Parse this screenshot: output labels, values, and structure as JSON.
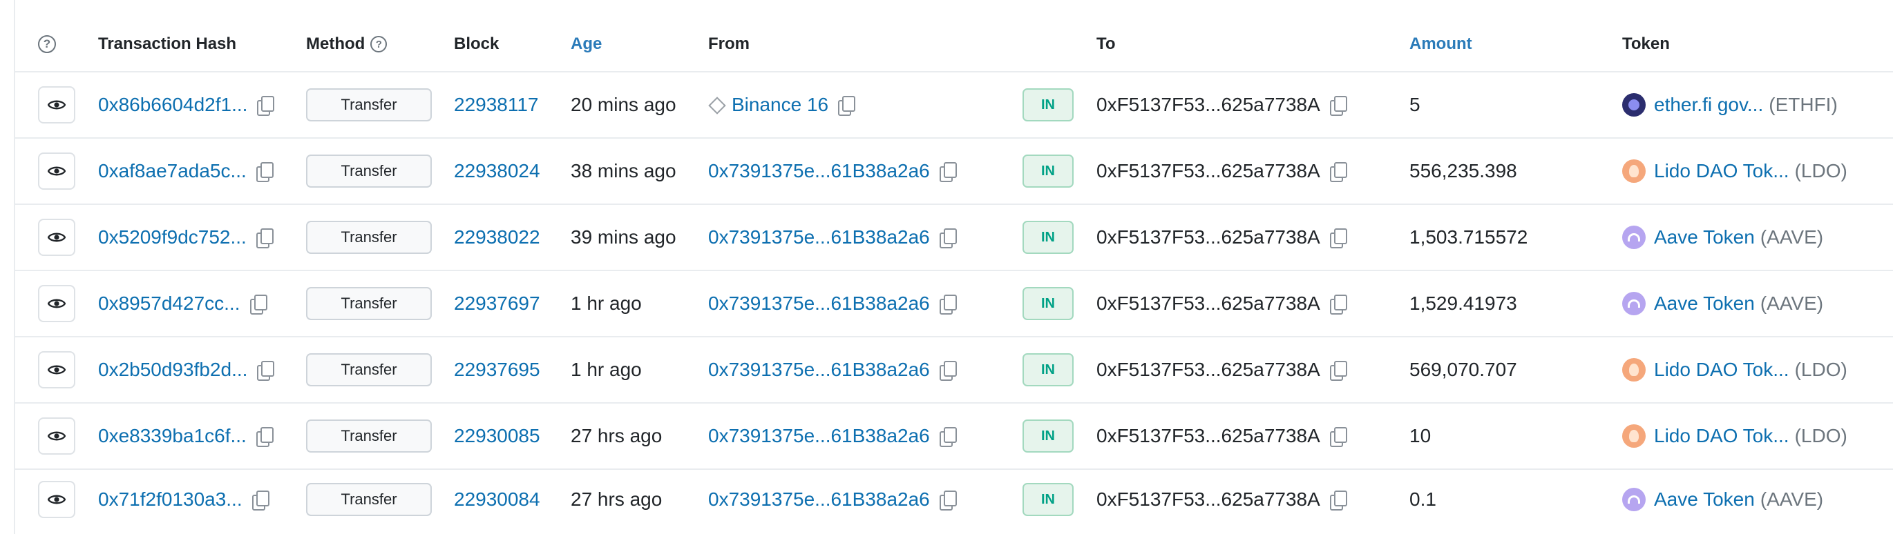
{
  "header": {
    "info_icon": "question-circle-icon",
    "transaction_hash": "Transaction Hash",
    "method": "Method",
    "block": "Block",
    "age": "Age",
    "from": "From",
    "to": "To",
    "amount": "Amount",
    "token": "Token"
  },
  "colors": {
    "link": "#0d6fb0",
    "in_badge_text": "#00a186",
    "in_badge_bg": "#e6f4ec"
  },
  "rows": [
    {
      "hash": "0x86b6604d2f1...",
      "method": "Transfer",
      "block": "22938117",
      "age": "20 mins ago",
      "from": "Binance 16",
      "from_is_contract": true,
      "direction": "IN",
      "to": "0xF5137F53...625a7738A",
      "amount": "5",
      "token_name": "ether.fi gov...",
      "token_symbol": "(ETHFI)",
      "token_logo": "ethfi"
    },
    {
      "hash": "0xaf8ae7ada5c...",
      "method": "Transfer",
      "block": "22938024",
      "age": "38 mins ago",
      "from": "0x7391375e...61B38a2a6",
      "from_is_contract": false,
      "direction": "IN",
      "to": "0xF5137F53...625a7738A",
      "amount": "556,235.398",
      "token_name": "Lido DAO Tok...",
      "token_symbol": "(LDO)",
      "token_logo": "ldo"
    },
    {
      "hash": "0x5209f9dc752...",
      "method": "Transfer",
      "block": "22938022",
      "age": "39 mins ago",
      "from": "0x7391375e...61B38a2a6",
      "from_is_contract": false,
      "direction": "IN",
      "to": "0xF5137F53...625a7738A",
      "amount": "1,503.715572",
      "token_name": "Aave Token",
      "token_symbol": "(AAVE)",
      "token_logo": "aave"
    },
    {
      "hash": "0x8957d427cc...",
      "method": "Transfer",
      "block": "22937697",
      "age": "1 hr ago",
      "from": "0x7391375e...61B38a2a6",
      "from_is_contract": false,
      "direction": "IN",
      "to": "0xF5137F53...625a7738A",
      "amount": "1,529.41973",
      "token_name": "Aave Token",
      "token_symbol": "(AAVE)",
      "token_logo": "aave"
    },
    {
      "hash": "0x2b50d93fb2d...",
      "method": "Transfer",
      "block": "22937695",
      "age": "1 hr ago",
      "from": "0x7391375e...61B38a2a6",
      "from_is_contract": false,
      "direction": "IN",
      "to": "0xF5137F53...625a7738A",
      "amount": "569,070.707",
      "token_name": "Lido DAO Tok...",
      "token_symbol": "(LDO)",
      "token_logo": "ldo"
    },
    {
      "hash": "0xe8339ba1c6f...",
      "method": "Transfer",
      "block": "22930085",
      "age": "27 hrs ago",
      "from": "0x7391375e...61B38a2a6",
      "from_is_contract": false,
      "direction": "IN",
      "to": "0xF5137F53...625a7738A",
      "amount": "10",
      "token_name": "Lido DAO Tok...",
      "token_symbol": "(LDO)",
      "token_logo": "ldo"
    },
    {
      "hash": "0x71f2f0130a3...",
      "method": "Transfer",
      "block": "22930084",
      "age": "27 hrs ago",
      "from": "0x7391375e...61B38a2a6",
      "from_is_contract": false,
      "direction": "IN",
      "to": "0xF5137F53...625a7738A",
      "amount": "0.1",
      "token_name": "Aave Token",
      "token_symbol": "(AAVE)",
      "token_logo": "aave"
    }
  ]
}
